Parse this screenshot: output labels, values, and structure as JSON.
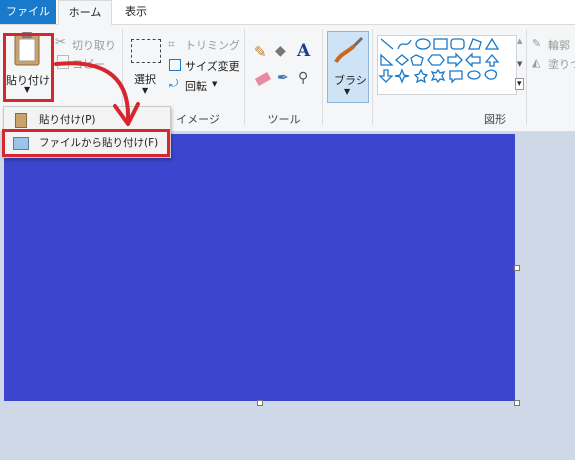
{
  "tabs": {
    "file": "ファイル",
    "home": "ホーム",
    "view": "表示"
  },
  "clipboard": {
    "paste_label": "貼り付け",
    "cut_label": "切り取り",
    "copy_label": "コピー"
  },
  "image_group": {
    "select_label": "選択",
    "crop_label": "トリミング",
    "resize_label": "サイズ変更",
    "rotate_label": "回転",
    "group_label": "イメージ"
  },
  "tools_group": {
    "group_label": "ツール"
  },
  "brush_label": "ブラシ",
  "shapes_group": {
    "group_label": "図形",
    "outline_label": "輪郭",
    "fill_label": "塗りつ"
  },
  "paste_menu": {
    "items": [
      {
        "label": "貼り付け(P)"
      },
      {
        "label": "ファイルから貼り付け(F)"
      }
    ]
  },
  "colors": {
    "accent": "#1979ca",
    "highlight": "#d7262e",
    "canvas_fill": "#3c45cd",
    "workspace": "#cfd8e6"
  }
}
